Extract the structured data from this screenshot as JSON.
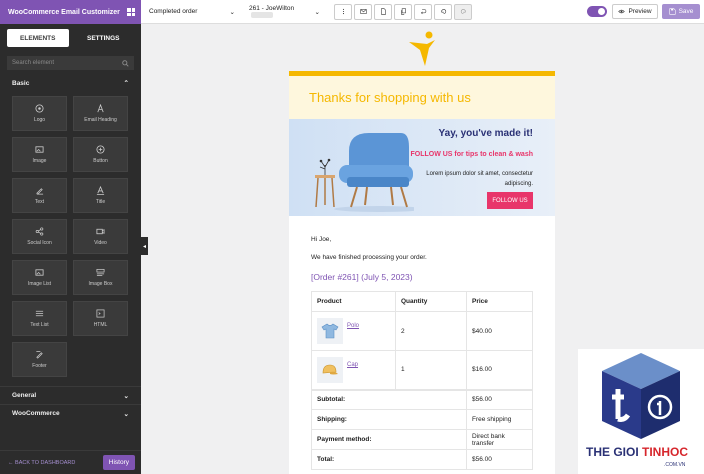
{
  "app": {
    "title": "WooCommerce Email Customizer"
  },
  "sidebar": {
    "tabs": [
      {
        "label": "ELEMENTS"
      },
      {
        "label": "SETTINGS"
      }
    ],
    "search_placeholder": "Search element",
    "basic_label": "Basic",
    "elements": [
      {
        "label": "Logo",
        "icon": "logo-icon"
      },
      {
        "label": "Email Heading",
        "icon": "heading-icon"
      },
      {
        "label": "Image",
        "icon": "image-icon"
      },
      {
        "label": "Button",
        "icon": "button-icon"
      },
      {
        "label": "Text",
        "icon": "text-icon"
      },
      {
        "label": "Title",
        "icon": "title-icon"
      },
      {
        "label": "Social Icon",
        "icon": "share-icon"
      },
      {
        "label": "Video",
        "icon": "video-icon"
      },
      {
        "label": "Image List",
        "icon": "image-list-icon"
      },
      {
        "label": "Image Box",
        "icon": "image-box-icon"
      },
      {
        "label": "Text List",
        "icon": "list-icon"
      },
      {
        "label": "HTML",
        "icon": "code-icon"
      },
      {
        "label": "Footer",
        "icon": "footer-icon"
      }
    ],
    "sections": [
      {
        "label": "General"
      },
      {
        "label": "WooCommerce"
      }
    ],
    "back_label": "BACK TO DASHBOARD",
    "history_label": "History"
  },
  "toolbar": {
    "template": "Completed order",
    "order": "261 - JoeWilton",
    "preview_label": "Preview",
    "save_label": "Save"
  },
  "email": {
    "heading": "Thanks for shopping with us",
    "banner_title": "Yay, you've made it!",
    "banner_follow": "FOLLOW US for tips to clean & wash",
    "banner_text": "Lorem ipsum dolor sit amet, consectetur adipiscing.",
    "banner_button": "FOLLOW US",
    "greeting": "Hi Joe,",
    "message": "We have finished processing your order.",
    "order_link": "[Order #261] (July 5, 2023)",
    "table_headers": [
      "Product",
      "Quantity",
      "Price"
    ],
    "products": [
      {
        "name": "Polo",
        "qty": "2",
        "price": "$40.00"
      },
      {
        "name": "Cap",
        "qty": "1",
        "price": "$16.00"
      }
    ],
    "totals": [
      {
        "label": "Subtotal:",
        "value": "$56.00"
      },
      {
        "label": "Shipping:",
        "value": "Free shipping"
      },
      {
        "label": "Payment method:",
        "value": "Direct bank transfer"
      },
      {
        "label": "Total:",
        "value": "$56.00"
      }
    ]
  },
  "watermark": {
    "brand_a": "THE GIOI ",
    "brand_b": "TINHOC",
    "sub": ".COM.VN"
  },
  "colors": {
    "accent": "#7f54b3",
    "brand_yellow": "#f5b800",
    "pink": "#e8356a",
    "navy": "#2a3175"
  }
}
